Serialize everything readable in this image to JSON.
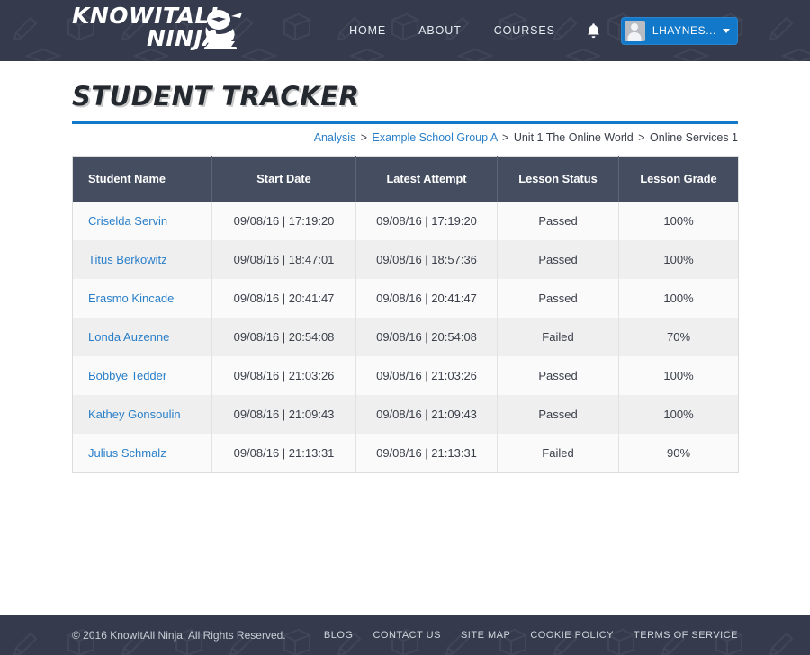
{
  "colors": {
    "header_bg": "#353b4d",
    "accent_blue": "#1378c8",
    "link_blue": "#2a7fc9",
    "table_header_bg": "#454e61",
    "row_odd": "#fafafa",
    "row_even": "#efefef"
  },
  "header": {
    "logo_line1": "KNOWITALL",
    "logo_line2": "NINJA",
    "logo_icon": "ninja-mascot-icon",
    "nav": [
      {
        "label": "HOME",
        "name": "nav-home"
      },
      {
        "label": "ABOUT",
        "name": "nav-about"
      },
      {
        "label": "COURSES",
        "name": "nav-courses"
      }
    ],
    "bell_icon": "notification-bell-icon",
    "user": {
      "name": "LHAYNES...",
      "avatar_icon": "user-avatar-icon",
      "caret_icon": "chevron-down-icon"
    }
  },
  "main": {
    "title": "STUDENT TRACKER",
    "breadcrumb": {
      "items": [
        {
          "label": "Analysis",
          "link": true
        },
        {
          "label": "Example School Group A",
          "link": true
        },
        {
          "label": "Unit 1 The Online World",
          "link": false
        },
        {
          "label": "Online Services 1",
          "link": false
        }
      ],
      "separator": ">"
    },
    "table": {
      "columns": [
        "Student Name",
        "Start Date",
        "Latest Attempt",
        "Lesson Status",
        "Lesson Grade"
      ],
      "rows": [
        {
          "student": "Criselda Servin",
          "start_date": "09/08/16 | 17:19:20",
          "latest_attempt": "09/08/16 | 17:19:20",
          "status": "Passed",
          "grade": "100%"
        },
        {
          "student": "Titus Berkowitz",
          "start_date": "09/08/16 | 18:47:01",
          "latest_attempt": "09/08/16 | 18:57:36",
          "status": "Passed",
          "grade": "100%"
        },
        {
          "student": "Erasmo Kincade",
          "start_date": "09/08/16 | 20:41:47",
          "latest_attempt": "09/08/16 | 20:41:47",
          "status": "Passed",
          "grade": "100%"
        },
        {
          "student": "Londa Auzenne",
          "start_date": "09/08/16 | 20:54:08",
          "latest_attempt": "09/08/16 | 20:54:08",
          "status": "Failed",
          "grade": "70%"
        },
        {
          "student": "Bobbye Tedder",
          "start_date": "09/08/16 | 21:03:26",
          "latest_attempt": "09/08/16 | 21:03:26",
          "status": "Passed",
          "grade": "100%"
        },
        {
          "student": "Kathey Gonsoulin",
          "start_date": "09/08/16 | 21:09:43",
          "latest_attempt": "09/08/16 | 21:09:43",
          "status": "Passed",
          "grade": "100%"
        },
        {
          "student": "Julius Schmalz",
          "start_date": "09/08/16 | 21:13:31",
          "latest_attempt": "09/08/16 | 21:13:31",
          "status": "Failed",
          "grade": "90%"
        }
      ]
    }
  },
  "footer": {
    "copyright": "© 2016 KnowItAll Ninja. All Rights Reserved.",
    "links": [
      {
        "label": "BLOG",
        "name": "footer-blog"
      },
      {
        "label": "CONTACT US",
        "name": "footer-contact-us"
      },
      {
        "label": "SITE MAP",
        "name": "footer-site-map"
      },
      {
        "label": "COOKIE POLICY",
        "name": "footer-cookie-policy"
      },
      {
        "label": "TERMS OF SERVICE",
        "name": "footer-terms-of-service"
      }
    ]
  }
}
